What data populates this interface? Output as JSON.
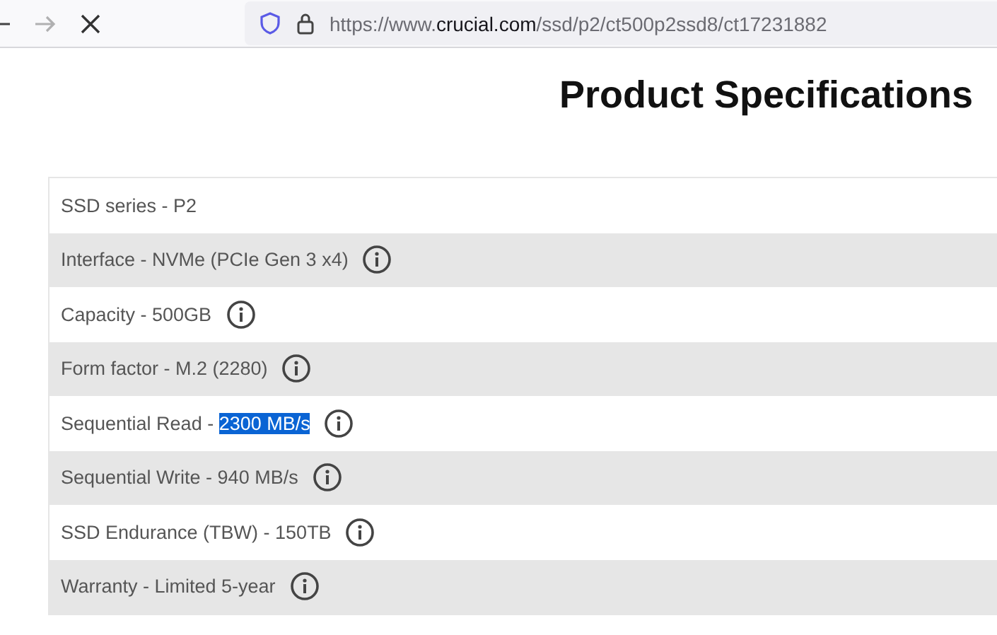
{
  "browser": {
    "forward_disabled": true,
    "url": {
      "prefix": "https://www.",
      "domain": "crucial.com",
      "path": "/ssd/p2/ct500p2ssd8/ct17231882"
    }
  },
  "page": {
    "title": "Product Specifications",
    "specs": [
      {
        "text": "SSD series - P2",
        "info_icon": false
      },
      {
        "text": "Interface - NVMe (PCIe Gen 3 x4)",
        "info_icon": true
      },
      {
        "text": "Capacity - 500GB",
        "info_icon": true
      },
      {
        "text": "Form factor - M.2 (2280)",
        "info_icon": true
      },
      {
        "text": "Sequential Read - ",
        "selected_text": "2300 MB/s",
        "info_icon": true
      },
      {
        "text": "Sequential Write - 940 MB/s",
        "info_icon": true
      },
      {
        "text": "SSD Endurance (TBW) - 150TB",
        "info_icon": true
      },
      {
        "text": "Warranty - Limited 5-year",
        "info_icon": true
      }
    ]
  }
}
